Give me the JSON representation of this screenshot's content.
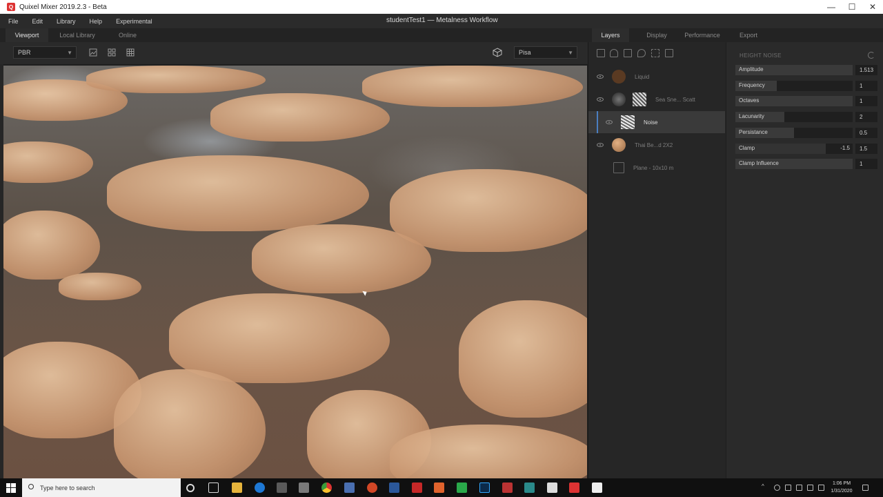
{
  "window": {
    "title": "Quixel Mixer 2019.2.3 - Beta",
    "minimize_glyph": "—",
    "maximize_glyph": "☐",
    "close_glyph": "✕"
  },
  "menu": {
    "items": [
      "File",
      "Edit",
      "Library",
      "Help",
      "Experimental"
    ],
    "project_title": "studentTest1 — Metalness Workflow"
  },
  "left_tabs": [
    "Viewport",
    "Local Library",
    "Online"
  ],
  "right_tabs": [
    "Layers",
    "Display",
    "Performance",
    "Export"
  ],
  "viewport_toolbar": {
    "render_mode": "PBR",
    "environment": "Pisa"
  },
  "layers": [
    {
      "name": "Liquid",
      "thumb_color": "#5a3a22"
    },
    {
      "name": "Sea Sne... Scatt",
      "thumb_color": "#555555"
    },
    {
      "name": "Noise",
      "thumb_color": "#bdbdbd",
      "selected": true
    },
    {
      "name": "Thai Be...d 2X2",
      "thumb_color": "#c98f5e"
    },
    {
      "name": "Plane - 10x10 m",
      "thumb_color": "#2a2a2a"
    }
  ],
  "properties": {
    "title": "HEIGHT NOISE",
    "rows": [
      {
        "label": "Amplitude",
        "value": "1.513",
        "fill_fraction": 1.0
      },
      {
        "label": "Frequency",
        "value": "1",
        "fill_fraction": 0.35
      },
      {
        "label": "Octaves",
        "value": "1",
        "fill_fraction": 1.0
      },
      {
        "label": "Lacunarity",
        "value": "2",
        "fill_fraction": 0.42
      },
      {
        "label": "Persistance",
        "value": "0.5",
        "fill_fraction": 0.5
      },
      {
        "label": "Clamp",
        "inner_value": "-1.5",
        "value": "1.5",
        "fill_fraction": 0.77
      },
      {
        "label": "Clamp Influence",
        "value": "1",
        "fill_fraction": 1.0
      }
    ]
  },
  "taskbar": {
    "search_placeholder": "Type here to search",
    "time": "1:06 PM",
    "date": "1/31/2020"
  }
}
